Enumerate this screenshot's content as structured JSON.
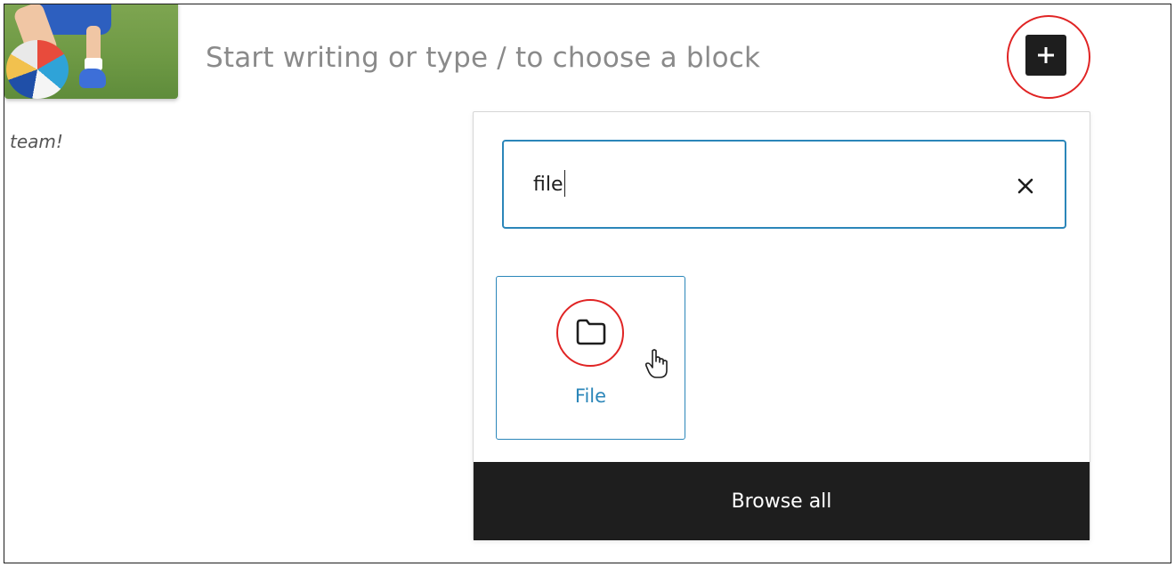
{
  "editor": {
    "caption_text": "team!",
    "placeholder": "Start writing or type / to choose a block",
    "add_block_icon": "plus-icon"
  },
  "inserter": {
    "search_value": "file",
    "clear_icon": "close-icon",
    "results": [
      {
        "label": "File",
        "icon": "folder-icon"
      }
    ],
    "browse_all_label": "Browse all"
  },
  "colors": {
    "accent": "#2b86b9",
    "dark": "#1e1e1e",
    "annotation": "#e02424",
    "placeholder_text": "#8a8a8a"
  }
}
